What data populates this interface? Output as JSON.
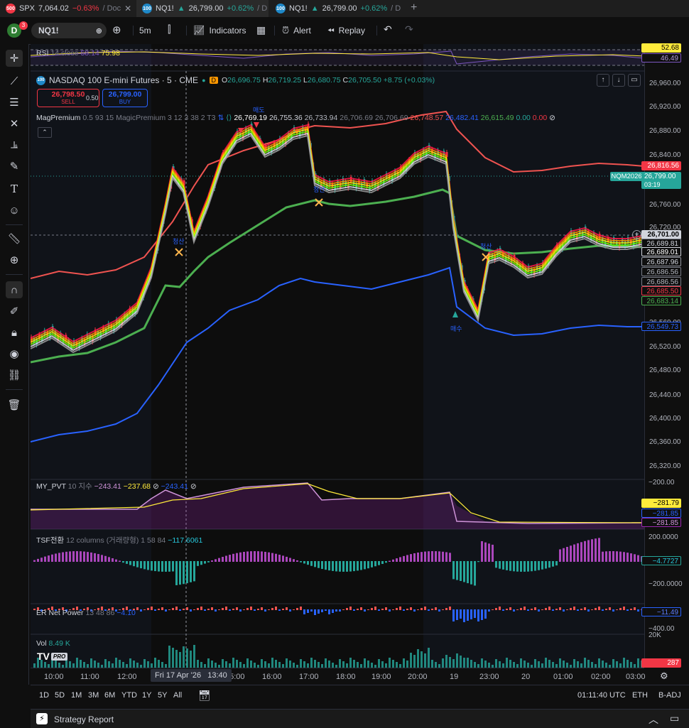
{
  "tabs": [
    {
      "icon_text": "500",
      "icon_color": "#f23645",
      "symbol": "SPX",
      "price": "7,064.02",
      "change": "−0.63%",
      "suffix": "/ Doc"
    },
    {
      "icon_text": "100",
      "icon_color": "#1e88c8",
      "symbol": "NQ1!",
      "arrow": "▲",
      "price": "26,799.00",
      "change": "+0.62%",
      "suffix": "/ D"
    },
    {
      "icon_text": "100",
      "icon_color": "#1e88c8",
      "symbol": "NQ1!",
      "arrow": "▲",
      "price": "26,799.00",
      "change": "+0.62%",
      "suffix": "/ D"
    }
  ],
  "toolbar": {
    "avatar": "D",
    "notif": "3",
    "symbol": "NQ1!",
    "interval": "5m",
    "indicators": "Indicators",
    "alert": "Alert",
    "replay": "Replay"
  },
  "rsi": {
    "name": "RSI",
    "params": "14 close",
    "v1": "58.14",
    "v2": "75.98",
    "p1": "52.68",
    "p2": "46.49"
  },
  "main": {
    "title": "NASDAQ 100 E-mini Futures · 5 · CME",
    "badge": "D",
    "o_label": "O",
    "o": "26,696.75",
    "h_label": "H",
    "h": "26,719.25",
    "l_label": "L",
    "l": "26,680.75",
    "c_label": "C",
    "c": "26,705.50",
    "chg": "+8.75 (+0.03%)",
    "sell_price": "26,798.50",
    "sell_label": "SELL",
    "spread": "0.50",
    "buy_price": "26,799.00",
    "buy_label": "BUY"
  },
  "mag": {
    "name": "MagPremium",
    "params": "0.5 93 15 MagicPremium 3 12 3 38 2 T3",
    "vals": [
      "26,769.19",
      "26,755.36",
      "26,733.94",
      "26,706.69",
      "26,706.69",
      "26,748.57",
      "26,482.41",
      "26,615.49",
      "0.00",
      "0.00"
    ]
  },
  "price_axis": [
    "26,960.00",
    "26,920.00",
    "26,880.00",
    "26,840.00",
    "26,760.00",
    "26,720.00",
    "26,560.00",
    "26,520.00",
    "26,480.00",
    "26,440.00",
    "26,400.00",
    "26,360.00",
    "26,320.00"
  ],
  "price_labels": {
    "red": "26,816.56",
    "contract": "NQM2026",
    "last": "26,799.00",
    "countdown": "03:19",
    "cross": "26,701.00",
    "l1": "26,689.81",
    "l2": "26,689.01",
    "l3": "26,687.96",
    "l4": "26,686.56",
    "l5": "26,686.56",
    "l6": "26,685.50",
    "l7": "26,683.14",
    "blue": "26,549.73"
  },
  "annot": {
    "sell": "매도",
    "buy": "매수",
    "close": "청산"
  },
  "pvt": {
    "name": "MY_PVT",
    "params": "10 지수",
    "v1": "−243.41",
    "v2": "−237.68",
    "v3": "−243.41",
    "axis": "−200.00",
    "p1": "−281.79",
    "p2": "−281.85",
    "p3": "−281.85"
  },
  "tsf": {
    "name": "TSF전환",
    "params": "12 columns (거래량형) 1 58 84",
    "v1": "−117.6061",
    "top": "200.0000",
    "mid": "−4.7727",
    "bot": "−200.0000"
  },
  "er": {
    "name": "ER Net Power",
    "params": "13 48 86",
    "v1": "−4.10",
    "val": "−11.49",
    "bot": "−400.00"
  },
  "vol": {
    "name": "Vol",
    "v1": "8.49 K",
    "top": "20K",
    "last": "287",
    "logo": "TV",
    "pro": "PRO"
  },
  "time_axis": [
    "10:00",
    "11:00",
    "12:00",
    "13:00",
    "15:00",
    "16:00",
    "17:00",
    "18:00",
    "19:00",
    "20:00",
    "19",
    "23:00",
    "20",
    "01:00",
    "02:00",
    "03:00"
  ],
  "time_cursor": "Fri 17 Apr '26   13:40",
  "range": {
    "buttons": [
      "1D",
      "5D",
      "1M",
      "3M",
      "6M",
      "YTD",
      "1Y",
      "5Y",
      "All"
    ],
    "clock": "01:11:40 UTC",
    "session": "ETH",
    "adj": "B-ADJ"
  },
  "strategy_report": "Strategy Report",
  "colors": {
    "up": "#26a69a",
    "down": "#f23645",
    "blue": "#2962ff",
    "green": "#4caf50",
    "red_band": "#ef5350",
    "purple": "#9c27b0",
    "yellow": "#ffeb3b"
  }
}
